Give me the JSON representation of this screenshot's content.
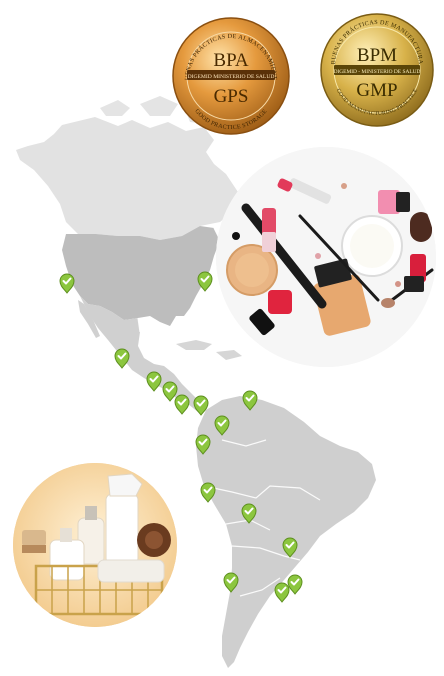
{
  "seals": {
    "bpa": {
      "abbr_top": "BPA",
      "abbr_bottom": "GPS",
      "ring_top": "BUENAS PRÁCTICAS DE ALMACENAMIENTO",
      "ring_bottom": "GOOD PRACTICE STORAGE",
      "ribbon": "DIGEMID MINISTERIO DE SALUD",
      "color": "#d9822b"
    },
    "bpm": {
      "abbr_top": "BPM",
      "abbr_bottom": "GMP",
      "ring_top": "BUENAS PRÁCTICAS DE MANUFACTURA",
      "ring_bottom": "GOOD MANUFACTURING PRACTICE",
      "ribbon": "DIGEMID - MINISTERIO DE SALUD",
      "color": "#c9a43a"
    }
  },
  "markers": {
    "icon": "check-pin-icon",
    "color": "#8cc63f",
    "count": 20
  },
  "photos": {
    "cosmetics": "cosmetics-photo",
    "cleaning": "cleaning-products-photo"
  }
}
